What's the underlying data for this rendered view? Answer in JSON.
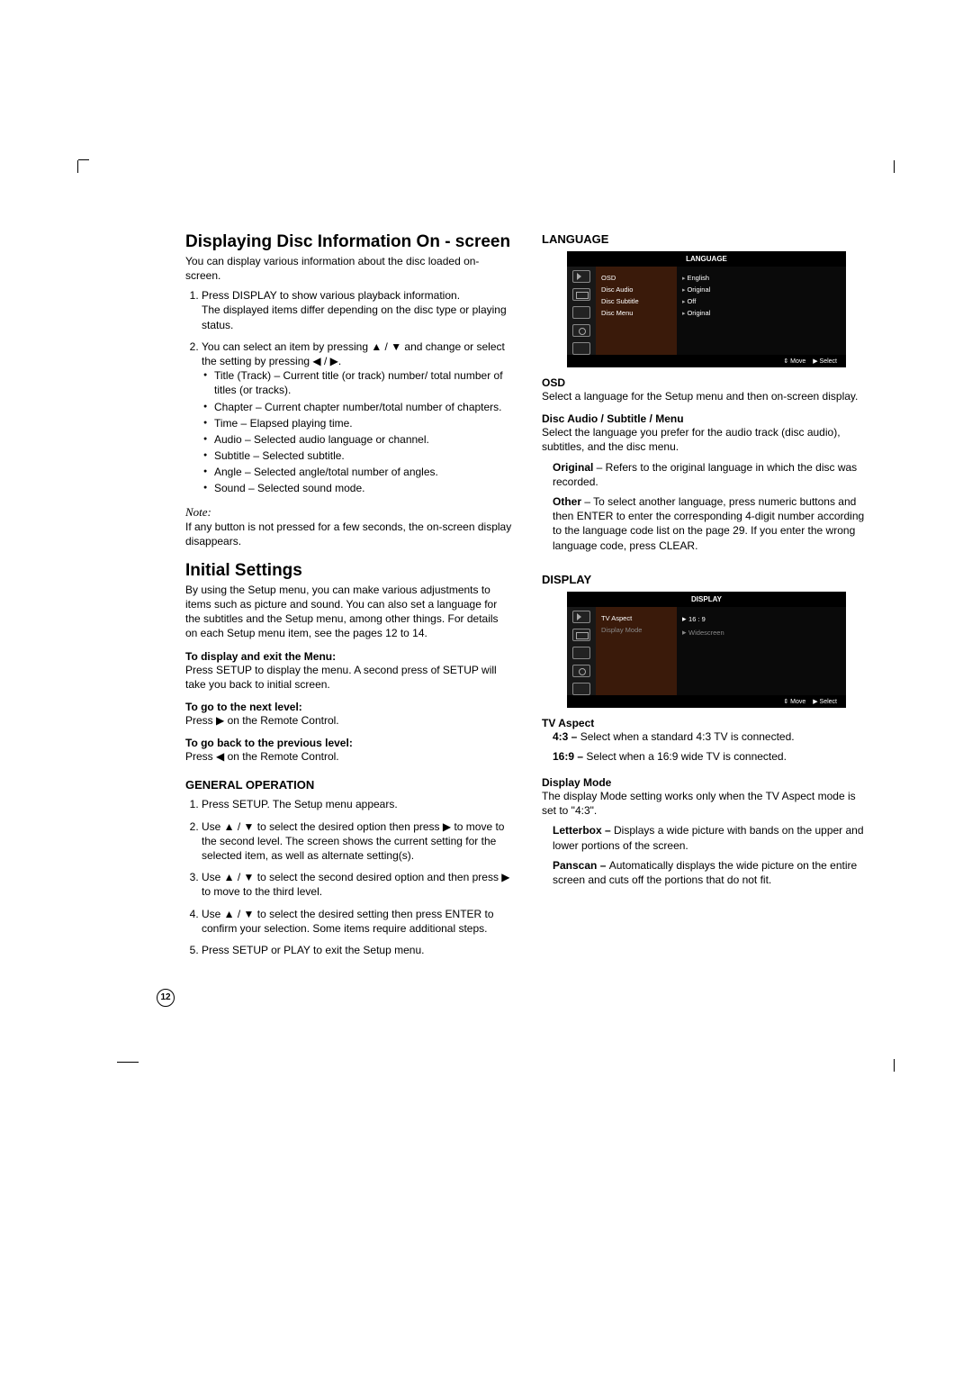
{
  "page_number": "12",
  "left": {
    "heading1": "Displaying Disc Information On - screen",
    "intro": "You can display various information about the disc loaded on-screen.",
    "ol": [
      {
        "text": "Press DISPLAY to show various playback information.",
        "sub": "The displayed items differ depending on the disc type or playing status."
      },
      {
        "text": "You can select an item by pressing ▲ / ▼ and change or select the setting by pressing ◀ / ▶.",
        "bullets": [
          "Title (Track) – Current title (or track) number/ total number of titles (or tracks).",
          "Chapter – Current chapter number/total number of chapters.",
          "Time – Elapsed playing time.",
          "Audio – Selected audio language or channel.",
          "Subtitle – Selected subtitle.",
          "Angle – Selected angle/total number of angles.",
          "Sound – Selected sound mode."
        ]
      }
    ],
    "note_label": "Note:",
    "note_text": "If any button is not pressed for a few seconds, the on-screen display disappears.",
    "heading2": "Initial Settings",
    "initial_text": "By using the Setup menu, you can make various adjustments to items such as picture and sound. You can also set a language for the subtitles and the Setup menu, among other things. For details on each Setup menu item, see  the pages 12 to 14.",
    "sub1_h": "To display and exit the Menu:",
    "sub1_t": "Press SETUP to display the menu. A second press of SETUP will take you back to initial screen.",
    "sub2_h": "To go to the next level:",
    "sub2_t": "Press ▶ on the Remote Control.",
    "sub3_h": "To go back to the previous level:",
    "sub3_t": "Press ◀ on the Remote Control.",
    "genop_h": "GENERAL OPERATION",
    "genop": [
      "Press SETUP. The Setup menu appears.",
      "Use ▲ / ▼ to select the desired option then press ▶ to move to the second level. The screen shows the current setting for the selected item, as well as alternate setting(s).",
      "Use ▲ / ▼ to select the second desired option and then press ▶ to move to the third level.",
      "Use ▲ / ▼ to select the desired setting then press ENTER to confirm your selection. Some items require additional steps.",
      "Press SETUP or PLAY to exit the Setup menu."
    ]
  },
  "right": {
    "lang_h": "LANGUAGE",
    "lang_panel": {
      "title": "LANGUAGE",
      "labels": [
        "OSD",
        "Disc Audio",
        "Disc Subtitle",
        "Disc Menu"
      ],
      "values": [
        "English",
        "Original",
        "Off",
        "Original"
      ],
      "footer_move": "⇕ Move",
      "footer_select": "▶  Select"
    },
    "osd_h": "OSD",
    "osd_t": "Select a language for the Setup menu and then on-screen display.",
    "dasm_h": "Disc Audio / Subtitle / Menu",
    "dasm_t": "Select the language you prefer for the audio track (disc audio), subtitles, and the disc menu.",
    "original_b": "Original",
    "original_t": " – Refers to the original language in which the disc was recorded.",
    "other_b": "Other",
    "other_t": " – To select another language, press numeric buttons and then ENTER to enter the corresponding 4-digit number according to the language code list on the page 29. If you enter the wrong language code, press CLEAR.",
    "disp_h": "DISPLAY",
    "disp_panel": {
      "title": "DISPLAY",
      "labels": [
        "TV Aspect",
        "Display Mode"
      ],
      "values": [
        "16 : 9",
        "Widescreen"
      ],
      "footer_move": "⇕ Move",
      "footer_select": "▶  Select"
    },
    "tva_h": "TV Aspect",
    "tva_43b": "4:3 – ",
    "tva_43t": "Select when a standard 4:3 TV is connected.",
    "tva_169b": "16:9 – ",
    "tva_169t": "Select when a 16:9 wide TV is connected.",
    "dm_h": "Display Mode",
    "dm_t": "The display Mode setting works only when the TV Aspect mode is set to \"4:3\".",
    "lb_b": "Letterbox – ",
    "lb_t": "Displays a wide picture with bands on the upper and lower portions of the screen.",
    "ps_b": "Panscan – ",
    "ps_t": "Automatically displays the wide picture on the entire screen and cuts off the portions that do not fit."
  }
}
